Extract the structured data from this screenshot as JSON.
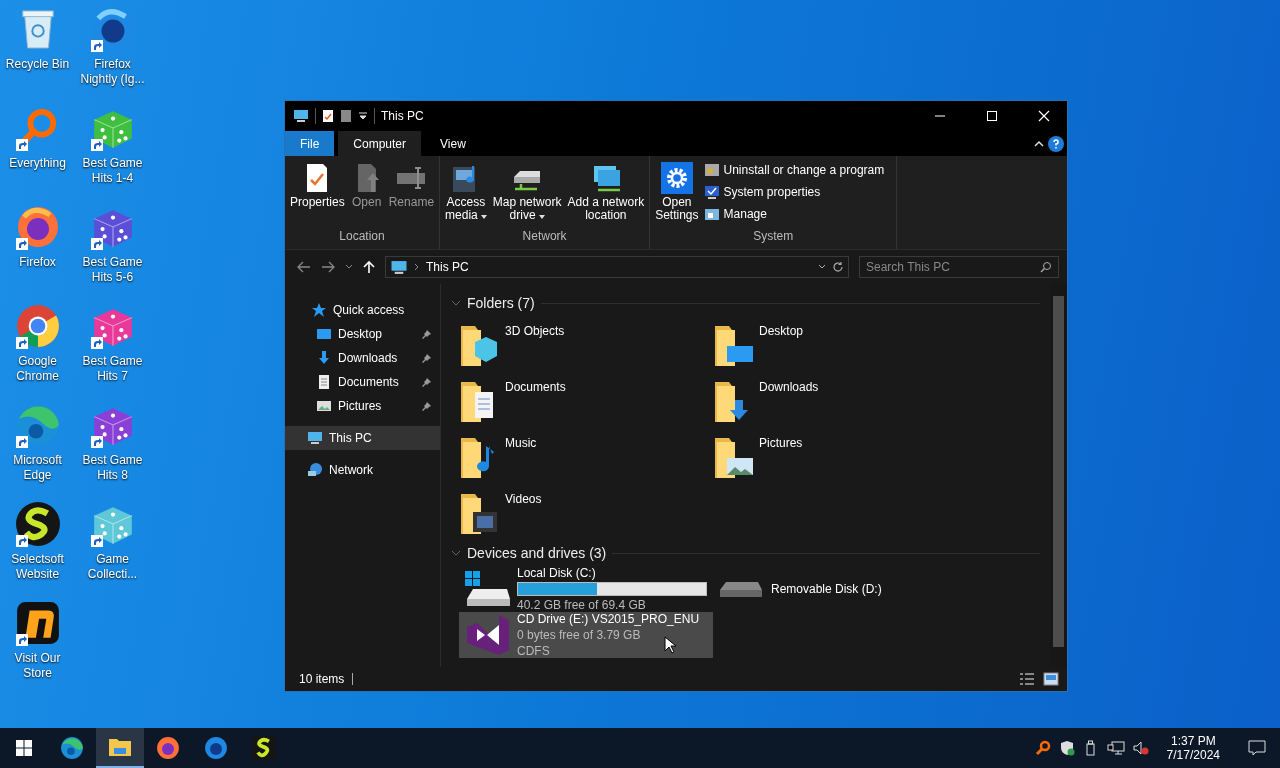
{
  "desktop_icons": [
    {
      "label": "Recycle Bin",
      "kind": "recycle",
      "shortcut": false
    },
    {
      "label": "Everything",
      "kind": "everything",
      "shortcut": true
    },
    {
      "label": "Firefox",
      "kind": "firefox",
      "shortcut": true
    },
    {
      "label": "Google Chrome",
      "kind": "chrome",
      "shortcut": true
    },
    {
      "label": "Microsoft Edge",
      "kind": "edge",
      "shortcut": true
    },
    {
      "label": "Selectsoft Website",
      "kind": "selectsoft",
      "shortcut": true
    },
    {
      "label": "Visit Our Store",
      "kind": "store",
      "shortcut": true
    },
    {
      "label": "Firefox Nightly (Ig...",
      "kind": "nightly",
      "shortcut": true
    },
    {
      "label": "Best Game Hits 1-4",
      "kind": "dice",
      "color": "#3fbf3f",
      "shortcut": true
    },
    {
      "label": "Best Game Hits 5-6",
      "kind": "dice",
      "color": "#5a4fd6",
      "shortcut": true
    },
    {
      "label": "Best Game Hits 7",
      "kind": "dice",
      "color": "#e8389a",
      "shortcut": true
    },
    {
      "label": "Best Game Hits 8",
      "kind": "dice",
      "color": "#8a3fd6",
      "shortcut": true
    },
    {
      "label": "Game Collecti...",
      "kind": "dice",
      "color": "#5fc8d8",
      "shortcut": true
    }
  ],
  "window": {
    "title": "This PC",
    "ribbon_tabs": [
      {
        "label": "File",
        "kind": "file",
        "selected": false
      },
      {
        "label": "Computer",
        "kind": "tab",
        "selected": true
      },
      {
        "label": "View",
        "kind": "tab",
        "selected": false
      }
    ],
    "ribbon_groups": [
      {
        "label": "Location",
        "buttons": [
          {
            "label": "Properties",
            "kind": "large",
            "disabled": false,
            "dropdown": false
          },
          {
            "label": "Open",
            "kind": "large",
            "disabled": true,
            "dropdown": false
          },
          {
            "label": "Rename",
            "kind": "large",
            "disabled": true,
            "dropdown": false
          }
        ]
      },
      {
        "label": "Network",
        "buttons": [
          {
            "label": "Access\nmedia",
            "kind": "large",
            "disabled": false,
            "dropdown": true
          },
          {
            "label": "Map network\ndrive",
            "kind": "large",
            "disabled": false,
            "dropdown": true
          },
          {
            "label": "Add a network\nlocation",
            "kind": "large",
            "disabled": false,
            "dropdown": false
          }
        ]
      },
      {
        "label": "System",
        "buttons": [
          {
            "label": "Open\nSettings",
            "kind": "large",
            "disabled": false,
            "dropdown": false
          },
          {
            "label": "Uninstall or change a program",
            "kind": "small",
            "disabled": false
          },
          {
            "label": "System properties",
            "kind": "small",
            "disabled": false
          },
          {
            "label": "Manage",
            "kind": "small",
            "disabled": false
          }
        ]
      }
    ],
    "address": "This PC",
    "search": {
      "placeholder": "Search This PC"
    },
    "nav": [
      {
        "label": "Quick access",
        "selected": false,
        "children": [
          {
            "label": "Desktop",
            "selected": false,
            "pinned": true
          },
          {
            "label": "Downloads",
            "selected": false,
            "pinned": true
          },
          {
            "label": "Documents",
            "selected": false,
            "pinned": true
          },
          {
            "label": "Pictures",
            "selected": false,
            "pinned": true
          }
        ]
      },
      {
        "label": "This PC",
        "selected": true
      },
      {
        "label": "Network",
        "selected": false
      }
    ],
    "folders_header": "Folders (7)",
    "folders": [
      {
        "label": "3D Objects",
        "kind": "cube"
      },
      {
        "label": "Desktop",
        "kind": "desktop"
      },
      {
        "label": "Documents",
        "kind": "documents"
      },
      {
        "label": "Downloads",
        "kind": "downloads"
      },
      {
        "label": "Music",
        "kind": "music"
      },
      {
        "label": "Pictures",
        "kind": "pictures"
      },
      {
        "label": "Videos",
        "kind": "videos"
      }
    ],
    "drives_header": "Devices and drives (3)",
    "drives": [
      {
        "name": "Local Disk (C:)",
        "kind": "system",
        "level": 0.42,
        "free": "40.2 GB free of 69.4 GB",
        "selected": false
      },
      {
        "name": "Removable Disk (D:)",
        "kind": "removable",
        "selected": false
      },
      {
        "name": "CD Drive (E:) VS2015_PRO_ENU",
        "kind": "cd",
        "free": "0 bytes free of 3.79 GB",
        "filesystem": "CDFS",
        "selected": true
      }
    ],
    "status": "10 items"
  },
  "taskbar": [
    {
      "kind": "start",
      "active": false
    },
    {
      "kind": "edge",
      "active": false
    },
    {
      "kind": "explorer",
      "active": true
    },
    {
      "kind": "firefox",
      "active": false
    },
    {
      "kind": "nightly",
      "active": false
    },
    {
      "kind": "selectsoft",
      "active": false
    }
  ],
  "clock": {
    "time": "1:37 PM",
    "date": "7/17/2024"
  }
}
